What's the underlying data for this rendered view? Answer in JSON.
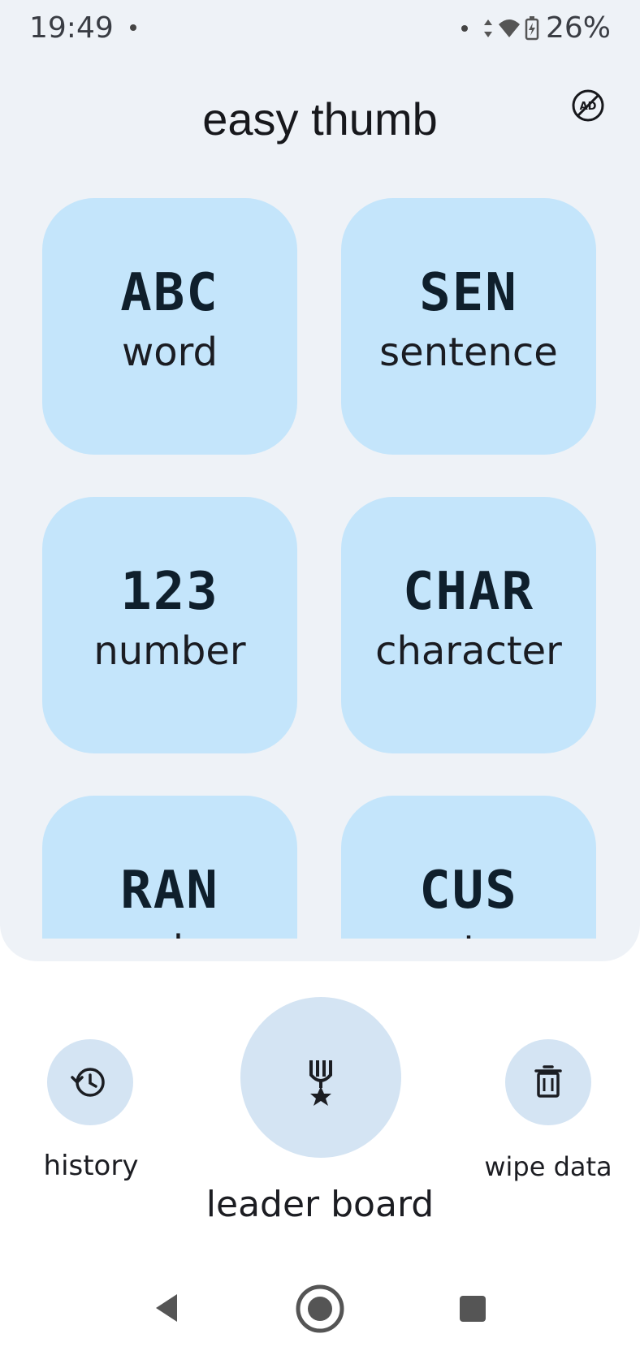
{
  "status": {
    "time": "19:49",
    "battery": "26%",
    "icons": [
      "data-arrows-icon",
      "wifi-icon",
      "signal-icon",
      "battery-icon"
    ]
  },
  "header": {
    "title": "easy thumb",
    "ad_icon": "ad-off-icon"
  },
  "tiles": [
    {
      "code": "ABC",
      "label": "word"
    },
    {
      "code": "SEN",
      "label": "sentence"
    },
    {
      "code": "123",
      "label": "number"
    },
    {
      "code": "CHAR",
      "label": "character"
    },
    {
      "code": "RAN",
      "label": "random"
    },
    {
      "code": "CUS",
      "label": "custom"
    }
  ],
  "bottom": {
    "history_label": "history",
    "history_icon": "history-icon",
    "leaderboard_label": "leader board",
    "leaderboard_icon": "medal-icon",
    "wipe_label": "wipe data",
    "wipe_icon": "trash-icon"
  },
  "nav": {
    "back_icon": "back-icon",
    "home_icon": "home-icon",
    "recents_icon": "recents-icon"
  },
  "colors": {
    "background": "#eef2f7",
    "tile": "#c4e5fb",
    "button": "#d4e4f3",
    "text": "#1b1d22"
  }
}
